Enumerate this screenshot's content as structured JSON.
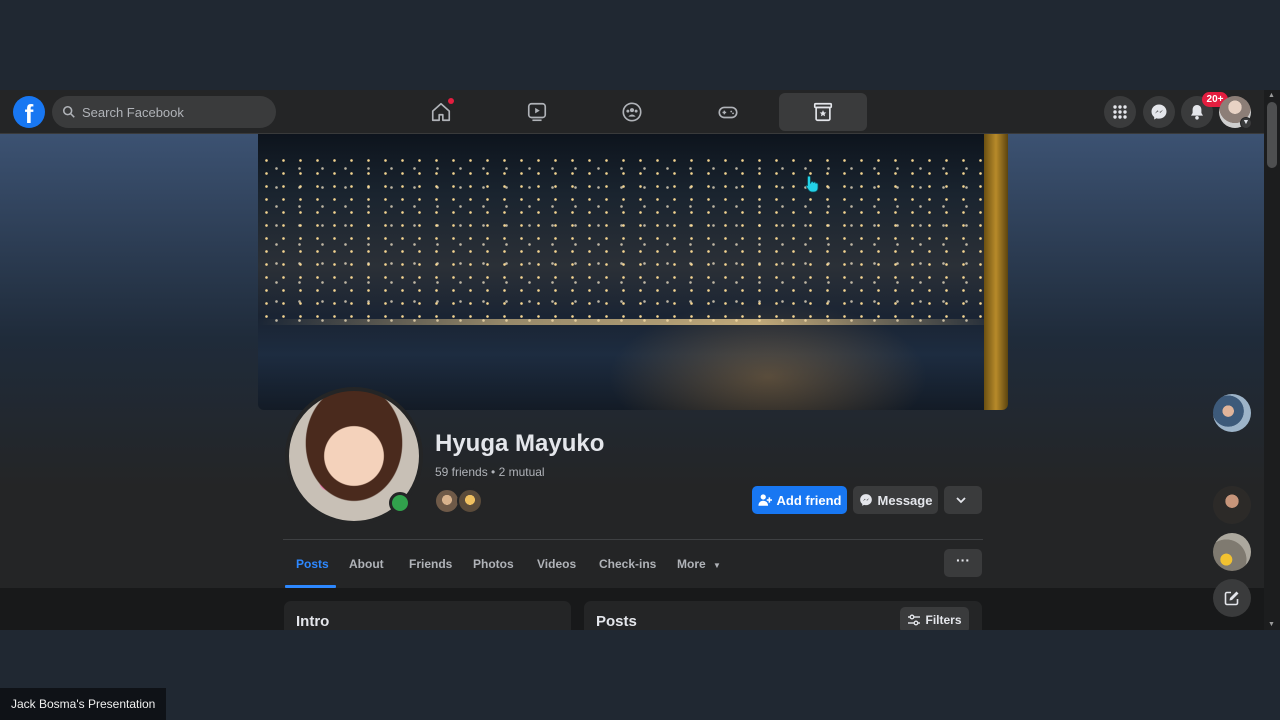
{
  "presenter_label": "Jack Bosma's Presentation",
  "brand": {
    "logo": "f",
    "accent": "#1877f2"
  },
  "search": {
    "placeholder": "Search Facebook",
    "icon": "search-icon"
  },
  "nav": {
    "tabs": [
      {
        "name": "home",
        "icon": "home-icon",
        "has_dot": true
      },
      {
        "name": "watch",
        "icon": "video-icon"
      },
      {
        "name": "groups",
        "icon": "groups-icon"
      },
      {
        "name": "gaming",
        "icon": "gamepad-icon"
      },
      {
        "name": "saved",
        "icon": "saved-icon",
        "active": true
      }
    ],
    "notifications_badge": "20+"
  },
  "profile": {
    "name": "Hyuga Mayuko",
    "friends_summary": "59 friends • 2 mutual",
    "online": true,
    "actions": {
      "add_friend": "Add friend",
      "message": "Message"
    }
  },
  "tabs": [
    "Posts",
    "About",
    "Friends",
    "Photos",
    "Videos",
    "Check-ins",
    "More"
  ],
  "active_tab": "Posts",
  "cards": {
    "intro_title": "Intro",
    "posts_title": "Posts",
    "filters_label": "Filters"
  },
  "colors": {
    "background": "#18191a",
    "surface": "#242526",
    "button": "#3a3b3c",
    "badge": "#e41e3f",
    "online": "#31a24c",
    "active_tab": "#2d88ff"
  }
}
